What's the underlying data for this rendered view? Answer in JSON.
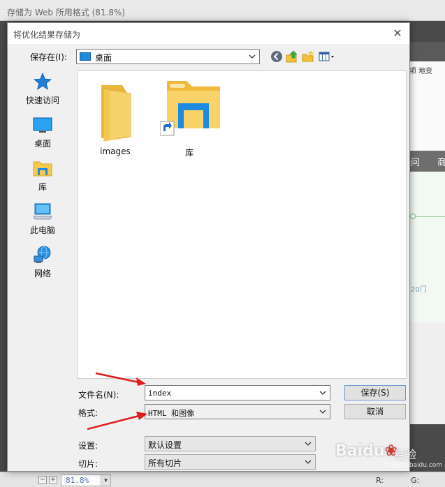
{
  "app": {
    "title": "存储为 Web 所用格式 (81.8%)",
    "right_tabs": "项   地变",
    "band_left": "问",
    "band_right": "商",
    "chart_label": "20门",
    "zoom": "81.8%",
    "readout_r": "R:",
    "readout_g": "G:"
  },
  "dialog": {
    "title": "将优化结果存储为",
    "save_in_label": "保存在(I):",
    "location": "桌面",
    "places": [
      {
        "label": "快速访问",
        "icon": "star-icon"
      },
      {
        "label": "桌面",
        "icon": "desktop-icon"
      },
      {
        "label": "库",
        "icon": "library-icon"
      },
      {
        "label": "此电脑",
        "icon": "computer-icon"
      },
      {
        "label": "网络",
        "icon": "network-icon"
      }
    ],
    "items": [
      {
        "label": "images",
        "icon": "folder-icon"
      },
      {
        "label": "库",
        "icon": "library-shortcut-icon"
      }
    ],
    "filename_label": "文件名(N):",
    "filename_value": "index",
    "format_label": "格式:",
    "format_value": "HTML 和图像",
    "settings_label": "设置:",
    "settings_value": "默认设置",
    "slices_label": "切片:",
    "slices_value": "所有切片",
    "save_button": "保存(S)",
    "cancel_button": "取消"
  },
  "watermark": {
    "brand": "Baidu",
    "text": "经验",
    "url": "jingyan.baidu.com"
  },
  "colors": {
    "dialog_bg": "#f0f0f0",
    "accent_blue": "#1d8be0",
    "folder_yellow": "#f5c94a",
    "arrow_red": "#e01b1b"
  }
}
